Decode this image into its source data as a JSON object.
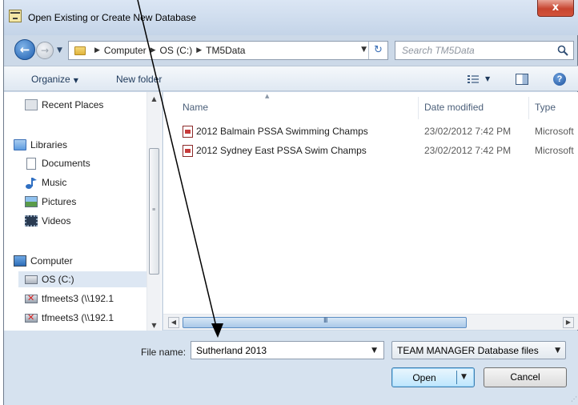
{
  "window": {
    "title": "Open Existing or Create New Database",
    "close_label": "x"
  },
  "navbar": {
    "path": [
      "Computer",
      "OS (C:)",
      "TM5Data"
    ],
    "search_placeholder": "Search TM5Data"
  },
  "toolbar": {
    "organize_label": "Organize",
    "new_folder_label": "New folder"
  },
  "nav_pane": {
    "items": [
      {
        "label": "Recent Places",
        "icon": "recent-places-icon"
      },
      {
        "label": "Libraries",
        "icon": "libraries-icon"
      },
      {
        "label": "Documents",
        "icon": "documents-icon"
      },
      {
        "label": "Music",
        "icon": "music-icon"
      },
      {
        "label": "Pictures",
        "icon": "pictures-icon"
      },
      {
        "label": "Videos",
        "icon": "videos-icon"
      },
      {
        "label": "Computer",
        "icon": "computer-icon"
      },
      {
        "label": "OS (C:)",
        "icon": "drive-icon",
        "selected": true
      },
      {
        "label": "tfmeets3 (\\\\192.1",
        "icon": "network-drive-icon"
      },
      {
        "label": "tfmeets3 (\\\\192.1",
        "icon": "network-drive-icon"
      }
    ]
  },
  "file_list": {
    "columns": [
      "Name",
      "Date modified",
      "Type"
    ],
    "rows": [
      {
        "name": "2012 Balmain PSSA Swimming Champs",
        "date": "23/02/2012 7:42 PM",
        "type": "Microsoft"
      },
      {
        "name": "2012 Sydney East PSSA Swim Champs",
        "date": "23/02/2012 7:42 PM",
        "type": "Microsoft"
      }
    ]
  },
  "bottom": {
    "file_name_label": "File name:",
    "file_name_value": "Sutherland 2013",
    "filter_value": "TEAM MANAGER Database files",
    "open_label": "Open",
    "cancel_label": "Cancel"
  },
  "annotation": {
    "color": "#000000"
  }
}
